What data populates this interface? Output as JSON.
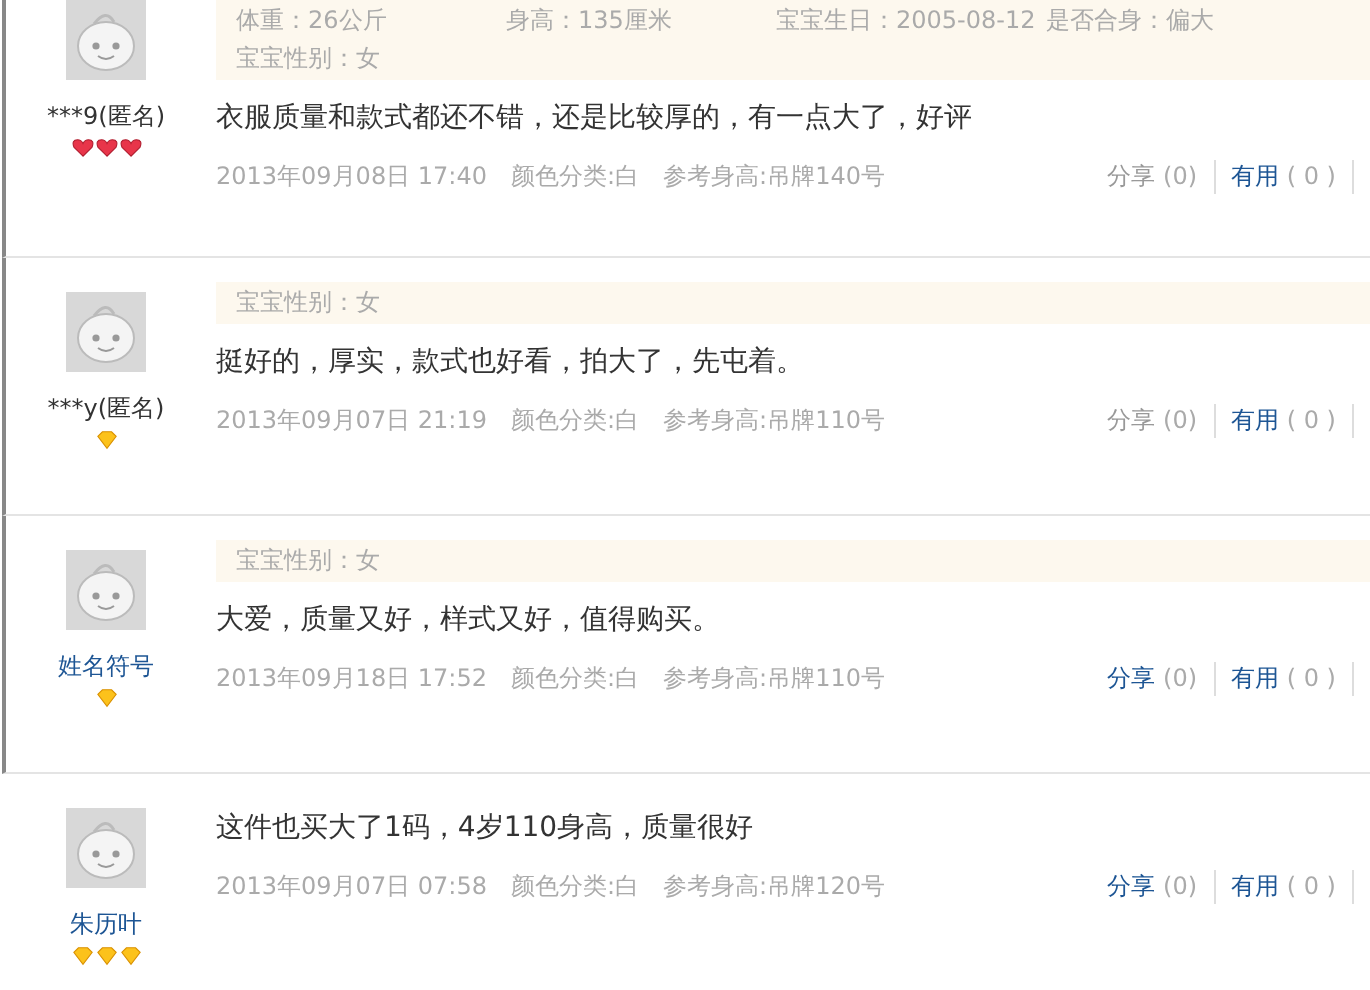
{
  "reviews": [
    {
      "user": "***9(匿名)",
      "badges": [
        {
          "kind": "heart"
        },
        {
          "kind": "heart"
        },
        {
          "kind": "heart"
        }
      ],
      "attributes": [
        [
          {
            "label": "体重：26公斤"
          },
          {
            "label": "身高：135厘米"
          },
          {
            "label": "宝宝生日：2005-08-12"
          },
          {
            "label": "是否合身：偏大"
          }
        ],
        [
          {
            "label": "宝宝性别：女"
          }
        ]
      ],
      "comment": "衣服质量和款式都还不错，还是比较厚的，有一点大了，好评",
      "date": "2013年09月08日 17:40",
      "color_option": "颜色分类:白",
      "size_option": "参考身高:吊牌140号",
      "share": {
        "label": "分享",
        "count": "(0)",
        "disabled": true
      },
      "useful": {
        "label": "有用",
        "count": "( 0 )"
      }
    },
    {
      "user": "***y(匿名)",
      "badges": [
        {
          "kind": "diamond"
        }
      ],
      "attributes": [
        [
          {
            "label": "宝宝性别：女"
          }
        ]
      ],
      "comment": "挺好的，厚实，款式也好看，拍大了，先屯着。",
      "date": "2013年09月07日 21:19",
      "color_option": "颜色分类:白",
      "size_option": "参考身高:吊牌110号",
      "share": {
        "label": "分享",
        "count": "(0)",
        "disabled": true
      },
      "useful": {
        "label": "有用",
        "count": "( 0 )"
      }
    },
    {
      "user": "姓名符号",
      "badges": [
        {
          "kind": "diamond"
        }
      ],
      "attributes": [
        [
          {
            "label": "宝宝性别：女"
          }
        ]
      ],
      "comment": "大爱，质量又好，样式又好，值得购买。",
      "date": "2013年09月18日 17:52",
      "color_option": "颜色分类:白",
      "size_option": "参考身高:吊牌110号",
      "share": {
        "label": "分享",
        "count": "(0)",
        "disabled": false
      },
      "useful": {
        "label": "有用",
        "count": "( 0 )"
      }
    },
    {
      "user": "朱历叶",
      "badges": [
        {
          "kind": "diamond"
        },
        {
          "kind": "diamond"
        },
        {
          "kind": "diamond"
        }
      ],
      "comment": "这件也买大了1码，4岁110身高，质量很好",
      "date": "2013年09月07日 07:58",
      "color_option": "颜色分类:白",
      "size_option": "参考身高:吊牌120号",
      "share": {
        "label": "分享",
        "count": "(0)",
        "disabled": false
      },
      "useful": {
        "label": "有用",
        "count": "( 0 )"
      }
    }
  ]
}
